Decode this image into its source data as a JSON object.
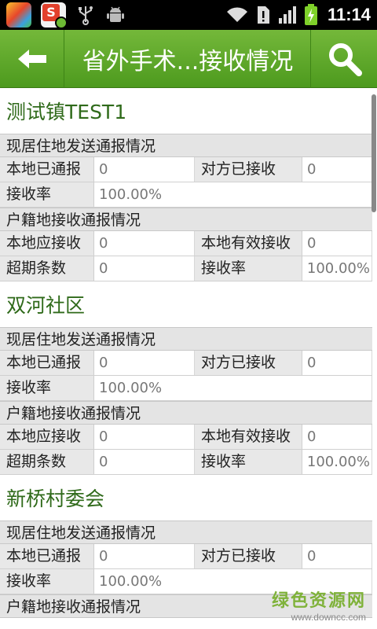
{
  "status_bar": {
    "time": "11:14",
    "app_badge_letter": "S"
  },
  "header": {
    "title": "省外手术...接收情况"
  },
  "sections": [
    {
      "title": "测试镇TEST1",
      "resident_header": "现居住地发送通报情况",
      "local_reported_label": "本地已通报",
      "local_reported_value": "0",
      "other_received_label": "对方已接收",
      "other_received_value": "0",
      "receive_rate_label": "接收率",
      "receive_rate_value": "100.00%",
      "household_header": "户籍地接收通报情况",
      "local_should_label": "本地应接收",
      "local_should_value": "0",
      "local_valid_label": "本地有效接收",
      "local_valid_value": "0",
      "overdue_label": "超期条数",
      "overdue_value": "0",
      "rate2_label": "接收率",
      "rate2_value": "100.00%"
    },
    {
      "title": "双河社区",
      "resident_header": "现居住地发送通报情况",
      "local_reported_label": "本地已通报",
      "local_reported_value": "0",
      "other_received_label": "对方已接收",
      "other_received_value": "0",
      "receive_rate_label": "接收率",
      "receive_rate_value": "100.00%",
      "household_header": "户籍地接收通报情况",
      "local_should_label": "本地应接收",
      "local_should_value": "0",
      "local_valid_label": "本地有效接收",
      "local_valid_value": "0",
      "overdue_label": "超期条数",
      "overdue_value": "0",
      "rate2_label": "接收率",
      "rate2_value": "100.00%"
    },
    {
      "title": "新桥村委会",
      "resident_header": "现居住地发送通报情况",
      "local_reported_label": "本地已通报",
      "local_reported_value": "0",
      "other_received_label": "对方已接收",
      "other_received_value": "0",
      "receive_rate_label": "接收率",
      "receive_rate_value": "100.00%",
      "household_header": "户籍地接收通报情况"
    }
  ],
  "watermark": {
    "text": "绿色资源网",
    "url": "www.downcc.com"
  },
  "colors": {
    "header_green": "#5ea52a",
    "section_title": "#2f6a1a"
  }
}
